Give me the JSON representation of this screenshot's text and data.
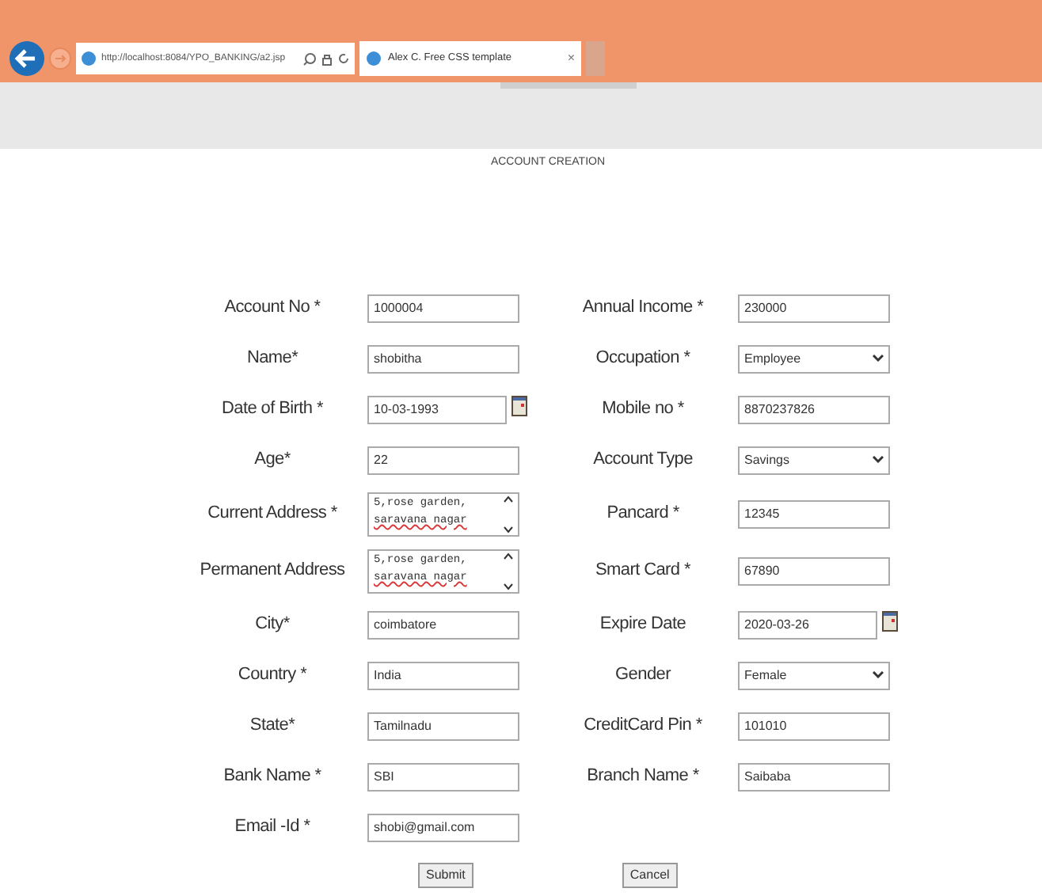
{
  "browser": {
    "address": "http://localhost:8084/YPO_BANKING/a2.jsp",
    "tab": {
      "title": "Alex C. Free CSS template",
      "close": "×"
    }
  },
  "page_title": "ACCOUNT CREATION",
  "rows": [
    {
      "left": {
        "label": "Account No *",
        "kind": "text",
        "value": "1000004"
      },
      "right": {
        "label": "Annual Income *",
        "kind": "text",
        "value": "230000"
      }
    },
    {
      "left": {
        "label": "Name*",
        "kind": "text",
        "value": "shobitha"
      },
      "right": {
        "label": "Occupation *",
        "kind": "select",
        "value": "Employee"
      }
    },
    {
      "left": {
        "label": "Date of Birth *",
        "kind": "date",
        "value": "10-03-1993"
      },
      "right": {
        "label": "Mobile no *",
        "kind": "text",
        "value": "8870237826"
      }
    },
    {
      "left": {
        "label": "Age*",
        "kind": "text",
        "value": "22"
      },
      "right": {
        "label": "Account Type",
        "kind": "select",
        "value": "Savings"
      }
    },
    {
      "left": {
        "label": "Current Address *",
        "kind": "textarea",
        "lines": [
          "5,rose garden,",
          "saravana nagar"
        ]
      },
      "right": {
        "label": "Pancard *",
        "kind": "text",
        "value": "12345"
      }
    },
    {
      "left": {
        "label": "Permanent Address",
        "kind": "textarea",
        "lines": [
          "5,rose garden,",
          "saravana nagar"
        ]
      },
      "right": {
        "label": "Smart Card *",
        "kind": "text",
        "value": "67890"
      }
    },
    {
      "left": {
        "label": "City*",
        "kind": "text",
        "value": "coimbatore"
      },
      "right": {
        "label": "Expire Date",
        "kind": "date",
        "value": "2020-03-26"
      }
    },
    {
      "left": {
        "label": "Country *",
        "kind": "text",
        "value": "India"
      },
      "right": {
        "label": "Gender",
        "kind": "select",
        "value": "Female"
      }
    },
    {
      "left": {
        "label": "State*",
        "kind": "text",
        "value": "Tamilnadu"
      },
      "right": {
        "label": "CreditCard Pin *",
        "kind": "text",
        "value": "101010"
      }
    },
    {
      "left": {
        "label": "Bank Name *",
        "kind": "text",
        "value": "SBI"
      },
      "right": {
        "label": "Branch Name *",
        "kind": "text",
        "value": "Saibaba"
      }
    },
    {
      "left": {
        "label": "Email -Id *",
        "kind": "text",
        "value": "shobi@gmail.com"
      }
    }
  ],
  "buttons": [
    "Submit",
    "Cancel"
  ]
}
